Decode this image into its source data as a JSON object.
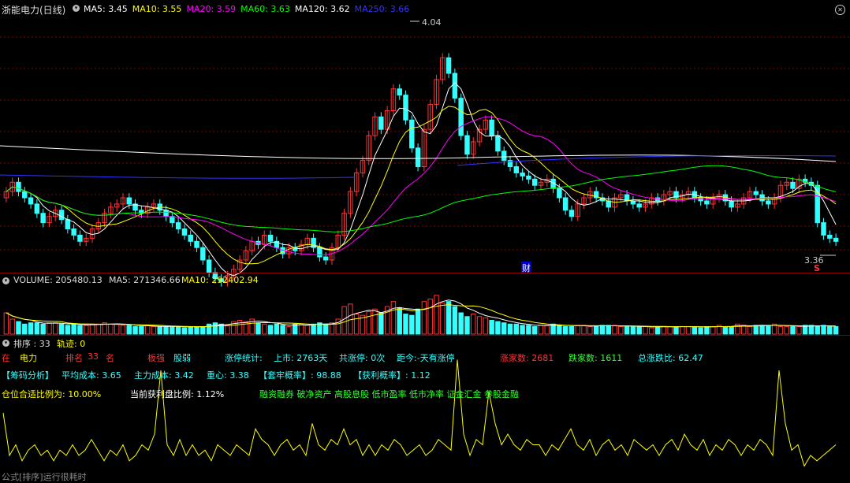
{
  "main": {
    "title": "浙能电力(日线)",
    "ma_legend": [
      {
        "text": "MA5: 3.45",
        "color": "#ffffff"
      },
      {
        "text": "MA10: 3.55",
        "color": "#ffff00"
      },
      {
        "text": "MA20: 3.59",
        "color": "#ff00ff"
      },
      {
        "text": "MA60: 3.63",
        "color": "#00ff00"
      },
      {
        "text": "MA120: 3.62",
        "color": "#ffffff"
      },
      {
        "text": "MA250: 3.66",
        "color": "#3333ff"
      }
    ],
    "high_label": "4.04",
    "low_label": "3.36",
    "badge_cai": "财",
    "badge_s": "S"
  },
  "volume": {
    "label": "VOLUME: 205480.13",
    "ma5": "MA5: 271346.66",
    "ma10": "MA10: 292402.94"
  },
  "indicator": {
    "label": "排序 : 33",
    "track": "轨迹: 0",
    "row1": {
      "zai": "在",
      "sector": "电力",
      "rank_label": "排名",
      "rank_value": "33",
      "rank_unit": "名",
      "board_label": "板强",
      "board_value": "股弱",
      "zt_label": "涨停统计:",
      "listed": "上市: 2763天",
      "total_zt": "共涨停: 0次",
      "since": "距今:-天有涨停",
      "up": "涨家数: 2681",
      "down": "跌家数: 1611",
      "ratio": "总涨跌比: 62.47"
    },
    "row2": {
      "chip": "【筹码分析】",
      "avg_cost": "平均成本: 3.65",
      "main_cost": "主力成本: 3.42",
      "center": "重心: 3.38",
      "trap": "【套牢概率】: 98.88",
      "profit": "【获利概率】: 1.12"
    },
    "row3": {
      "position": "仓位合适比例为: 10.00%",
      "profit_ratio": "当前获利盘比例: 1.12%",
      "tags": "融资融券 破净资产 高股息股 低市盈率 低市净率 证金汇金 参股金融"
    },
    "footer": "公式[排序]运行很耗时"
  },
  "colors": {
    "up": "#ff3333",
    "down": "#33ffff",
    "grid": "#8b0000"
  },
  "chart_data": {
    "type": "candlestick",
    "title": "浙能电力(日线)",
    "high": 4.04,
    "low": 3.36,
    "ylim": [
      3.3,
      4.08
    ],
    "closes": [
      3.52,
      3.55,
      3.52,
      3.5,
      3.48,
      3.45,
      3.42,
      3.44,
      3.46,
      3.43,
      3.4,
      3.38,
      3.36,
      3.37,
      3.4,
      3.42,
      3.45,
      3.47,
      3.48,
      3.5,
      3.48,
      3.46,
      3.45,
      3.47,
      3.48,
      3.46,
      3.44,
      3.42,
      3.4,
      3.38,
      3.36,
      3.34,
      3.3,
      3.26,
      3.24,
      3.23,
      3.25,
      3.27,
      3.3,
      3.33,
      3.36,
      3.35,
      3.38,
      3.36,
      3.34,
      3.32,
      3.34,
      3.33,
      3.35,
      3.37,
      3.34,
      3.31,
      3.3,
      3.34,
      3.38,
      3.45,
      3.52,
      3.58,
      3.62,
      3.7,
      3.76,
      3.72,
      3.78,
      3.85,
      3.83,
      3.75,
      3.66,
      3.6,
      3.72,
      3.8,
      3.88,
      3.95,
      3.9,
      3.82,
      3.7,
      3.64,
      3.68,
      3.72,
      3.75,
      3.7,
      3.65,
      3.62,
      3.6,
      3.58,
      3.57,
      3.56,
      3.54,
      3.55,
      3.56,
      3.53,
      3.5,
      3.46,
      3.44,
      3.48,
      3.5,
      3.52,
      3.5,
      3.49,
      3.47,
      3.5,
      3.51,
      3.49,
      3.48,
      3.47,
      3.48,
      3.5,
      3.49,
      3.51,
      3.52,
      3.5,
      3.51,
      3.52,
      3.5,
      3.49,
      3.48,
      3.5,
      3.51,
      3.49,
      3.47,
      3.48,
      3.5,
      3.52,
      3.51,
      3.49,
      3.48,
      3.5,
      3.54,
      3.55,
      3.53,
      3.56,
      3.55,
      3.54,
      3.42,
      3.38,
      3.37,
      3.36
    ],
    "volumes": [
      1.7,
      1.2,
      1.0,
      0.8,
      0.9,
      0.9,
      0.8,
      0.9,
      0.9,
      0.8,
      0.7,
      0.8,
      0.7,
      0.7,
      0.8,
      0.8,
      0.9,
      0.8,
      0.8,
      0.7,
      0.7,
      0.6,
      0.6,
      0.7,
      0.6,
      0.6,
      0.6,
      0.6,
      0.6,
      0.5,
      0.6,
      0.6,
      0.6,
      0.8,
      0.9,
      0.8,
      0.7,
      1.0,
      1.1,
      1.0,
      1.2,
      0.9,
      0.8,
      0.7,
      0.8,
      0.7,
      0.6,
      0.8,
      0.8,
      0.7,
      0.8,
      0.9,
      0.8,
      0.9,
      1.2,
      2.2,
      2.4,
      1.6,
      1.5,
      1.8,
      2.0,
      1.7,
      2.2,
      2.6,
      2.1,
      1.6,
      1.5,
      2.0,
      2.6,
      2.8,
      3.1,
      2.5,
      2.6,
      2.2,
      1.7,
      1.4,
      1.6,
      1.4,
      1.3,
      1.1,
      1.0,
      0.9,
      0.8,
      0.8,
      0.7,
      0.7,
      0.6,
      0.7,
      0.7,
      0.8,
      0.7,
      0.6,
      0.6,
      0.7,
      0.7,
      0.6,
      0.6,
      0.7,
      0.7,
      0.7,
      0.6,
      0.6,
      0.6,
      0.6,
      0.6,
      0.5,
      0.6,
      0.6,
      0.6,
      0.6,
      0.6,
      0.6,
      0.6,
      0.5,
      0.6,
      0.6,
      0.7,
      0.6,
      0.6,
      0.8,
      0.7,
      0.6,
      0.7,
      0.7,
      0.7,
      0.8,
      0.6,
      0.6,
      0.6,
      0.6,
      0.7,
      0.7,
      0.6,
      0.7,
      0.6,
      0.6
    ],
    "indicator_values": [
      0.6,
      0.2,
      0.3,
      0.15,
      0.25,
      0.3,
      0.2,
      0.25,
      0.15,
      0.25,
      0.2,
      0.3,
      0.2,
      0.25,
      0.35,
      0.25,
      0.15,
      0.25,
      0.2,
      0.3,
      0.15,
      0.2,
      0.3,
      0.25,
      0.4,
      1.0,
      0.3,
      0.2,
      0.35,
      0.2,
      0.3,
      0.2,
      0.25,
      0.15,
      0.3,
      0.25,
      0.2,
      0.3,
      0.25,
      0.2,
      0.45,
      0.35,
      0.3,
      0.2,
      0.3,
      0.35,
      0.25,
      0.3,
      0.2,
      0.5,
      0.3,
      0.25,
      0.35,
      0.3,
      0.45,
      0.3,
      0.35,
      0.2,
      0.3,
      0.2,
      0.3,
      0.25,
      0.35,
      0.3,
      0.2,
      0.25,
      0.3,
      0.2,
      0.25,
      0.35,
      0.3,
      0.25,
      1.1,
      0.4,
      0.2,
      0.35,
      0.3,
      0.8,
      0.5,
      0.3,
      0.4,
      0.3,
      0.25,
      0.35,
      0.3,
      0.3,
      0.2,
      0.3,
      0.25,
      0.35,
      0.45,
      0.3,
      0.25,
      0.35,
      0.2,
      0.3,
      0.35,
      0.25,
      0.3,
      0.2,
      0.35,
      0.3,
      0.25,
      0.3,
      0.2,
      0.3,
      0.35,
      0.25,
      0.4,
      0.3,
      0.25,
      0.35,
      0.2,
      0.3,
      0.25,
      0.35,
      0.3,
      0.2,
      0.3,
      0.25,
      0.35,
      0.3,
      0.2,
      1.0,
      0.5,
      0.25,
      0.3,
      0.1,
      0.2,
      0.15,
      0.2,
      0.25,
      0.3
    ]
  }
}
